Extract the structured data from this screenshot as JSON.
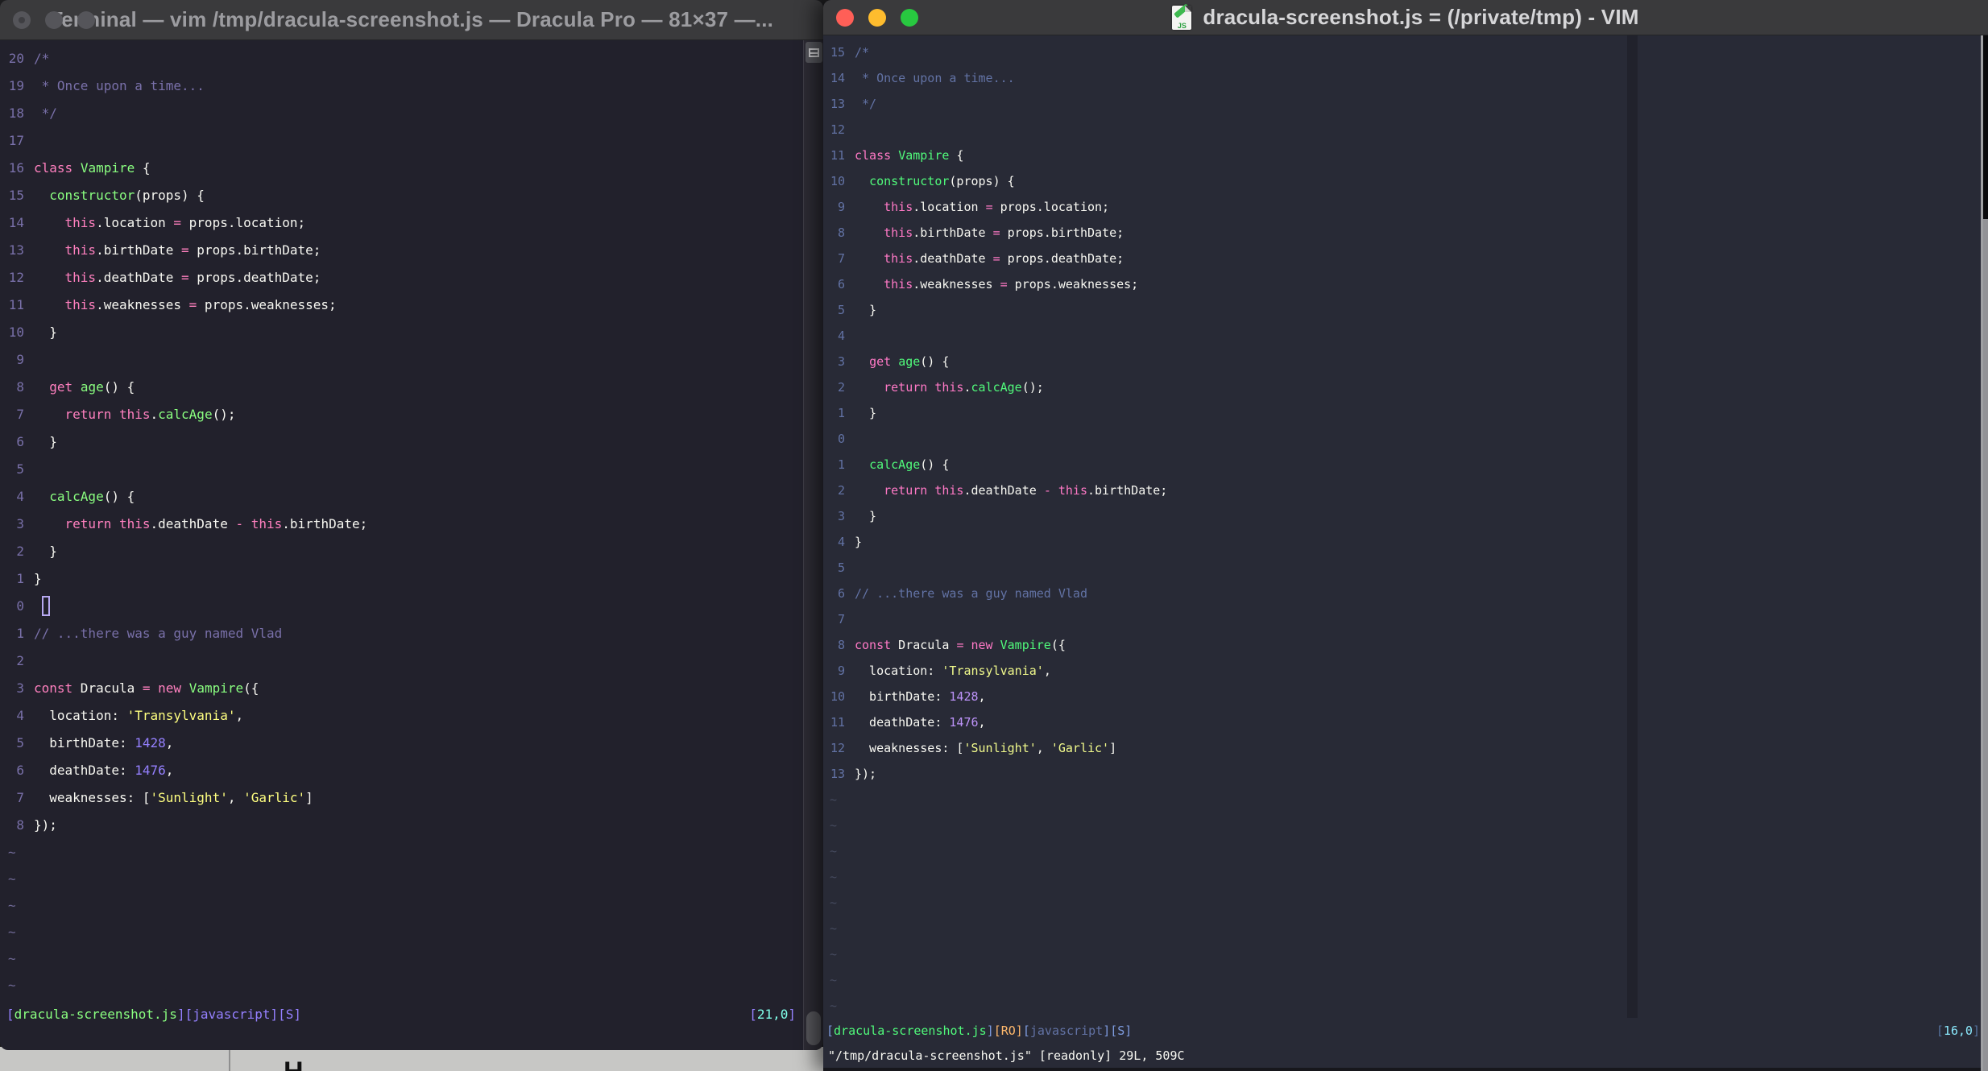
{
  "code_lines": [
    [
      [
        "c",
        "/*"
      ]
    ],
    [
      [
        "c",
        " * Once upon a time..."
      ]
    ],
    [
      [
        "c",
        " */"
      ]
    ],
    [],
    [
      [
        "p",
        "class"
      ],
      [
        "n",
        " "
      ],
      [
        "g",
        "Vampire"
      ],
      [
        "n",
        " {"
      ]
    ],
    [
      [
        "n",
        "  "
      ],
      [
        "g",
        "constructor"
      ],
      [
        "n",
        "(props) {"
      ]
    ],
    [
      [
        "n",
        "    "
      ],
      [
        "p",
        "this"
      ],
      [
        "n",
        ".location "
      ],
      [
        "p",
        "="
      ],
      [
        "n",
        " props.location;"
      ]
    ],
    [
      [
        "n",
        "    "
      ],
      [
        "p",
        "this"
      ],
      [
        "n",
        ".birthDate "
      ],
      [
        "p",
        "="
      ],
      [
        "n",
        " props.birthDate;"
      ]
    ],
    [
      [
        "n",
        "    "
      ],
      [
        "p",
        "this"
      ],
      [
        "n",
        ".deathDate "
      ],
      [
        "p",
        "="
      ],
      [
        "n",
        " props.deathDate;"
      ]
    ],
    [
      [
        "n",
        "    "
      ],
      [
        "p",
        "this"
      ],
      [
        "n",
        ".weaknesses "
      ],
      [
        "p",
        "="
      ],
      [
        "n",
        " props.weaknesses;"
      ]
    ],
    [
      [
        "n",
        "  }"
      ]
    ],
    [],
    [
      [
        "n",
        "  "
      ],
      [
        "p",
        "get"
      ],
      [
        "n",
        " "
      ],
      [
        "g",
        "age"
      ],
      [
        "n",
        "() {"
      ]
    ],
    [
      [
        "n",
        "    "
      ],
      [
        "p",
        "return"
      ],
      [
        "n",
        " "
      ],
      [
        "p",
        "this"
      ],
      [
        "n",
        "."
      ],
      [
        "g",
        "calcAge"
      ],
      [
        "n",
        "();"
      ]
    ],
    [
      [
        "n",
        "  }"
      ]
    ],
    [],
    [
      [
        "n",
        "  "
      ],
      [
        "g",
        "calcAge"
      ],
      [
        "n",
        "() {"
      ]
    ],
    [
      [
        "n",
        "    "
      ],
      [
        "p",
        "return"
      ],
      [
        "n",
        " "
      ],
      [
        "p",
        "this"
      ],
      [
        "n",
        ".deathDate "
      ],
      [
        "p",
        "-"
      ],
      [
        "n",
        " "
      ],
      [
        "p",
        "this"
      ],
      [
        "n",
        ".birthDate;"
      ]
    ],
    [
      [
        "n",
        "  }"
      ]
    ],
    [
      [
        "n",
        "}"
      ]
    ],
    [],
    [
      [
        "c",
        "// ...there was a guy named Vlad"
      ]
    ],
    [],
    [
      [
        "p",
        "const"
      ],
      [
        "n",
        " Dracula "
      ],
      [
        "p",
        "="
      ],
      [
        "n",
        " "
      ],
      [
        "p",
        "new"
      ],
      [
        "n",
        " "
      ],
      [
        "g",
        "Vampire"
      ],
      [
        "n",
        "({"
      ]
    ],
    [
      [
        "n",
        "  location: "
      ],
      [
        "y",
        "'Transylvania'"
      ],
      [
        "n",
        ","
      ]
    ],
    [
      [
        "n",
        "  birthDate: "
      ],
      [
        "u",
        "1428"
      ],
      [
        "n",
        ","
      ]
    ],
    [
      [
        "n",
        "  deathDate: "
      ],
      [
        "u",
        "1476"
      ],
      [
        "n",
        ","
      ]
    ],
    [
      [
        "n",
        "  weaknesses: ["
      ],
      [
        "y",
        "'Sunlight'"
      ],
      [
        "n",
        ", "
      ],
      [
        "y",
        "'Garlic'"
      ],
      [
        "n",
        "]"
      ]
    ],
    [
      [
        "n",
        "});"
      ]
    ]
  ],
  "left_window": {
    "titlebar": {
      "title": "Terminal — vim /tmp/dracula-screenshot.js — Dracula Pro — 81×37 —...",
      "traffic_lights": {
        "close": "#55555a",
        "minimize": "#55555a",
        "zoom": "#55555a"
      }
    },
    "theme_name": "Dracula Pro",
    "palette": {
      "bg": "#22212c",
      "fg": "#f8f8f2",
      "comment": "#7970a9",
      "linenr": "#7970a9",
      "pink": "#ff80bf",
      "green": "#8aff80",
      "yellow": "#ffff80",
      "purple": "#9580ff",
      "cyan": "#80ffea",
      "orange": "#ffca80",
      "blue": "#9580ff",
      "bracketdim": "#9580ff",
      "tilde": "#6e6894"
    },
    "line_numbers": [
      "20",
      "19",
      "18",
      "17",
      "16",
      "15",
      "14",
      "13",
      "12",
      "11",
      "10",
      " 9",
      " 8",
      " 7",
      " 6",
      " 5",
      " 4",
      " 3",
      " 2",
      " 1",
      " 0",
      " 1",
      " 2",
      " 3",
      " 4",
      " 5",
      " 6",
      " 7",
      " 8"
    ],
    "cursor_line_index": 20,
    "tilde": "~",
    "tilde_count": 6,
    "statusline": {
      "left_segments": [
        [
          "u",
          "["
        ],
        [
          "g",
          "dracula-screenshot.js"
        ],
        [
          "u",
          "][javascript][S]"
        ]
      ],
      "right_segments": [
        [
          "u",
          "["
        ],
        [
          "cy",
          "21,0"
        ],
        [
          "u",
          "]"
        ]
      ]
    },
    "cmdline": ""
  },
  "right_window": {
    "titlebar": {
      "title": "dracula-screenshot.js = (/private/tmp) - VIM",
      "icon_label": "JS",
      "traffic_lights": {
        "close": "#ff5f57",
        "minimize": "#febc2e",
        "zoom": "#28c840"
      }
    },
    "theme_name": "Dracula",
    "palette": {
      "bg": "#282a36",
      "fg": "#f8f8f2",
      "comment": "#6272a4",
      "linenr": "#6272a4",
      "pink": "#ff79c6",
      "green": "#50fa7b",
      "yellow": "#f1fa8c",
      "purple": "#bd93f9",
      "cyan": "#8be9fd",
      "orange": "#ffb86c",
      "blue": "#7e9ce0",
      "bracketdim": "#55729e",
      "tilde": "#454a5e"
    },
    "line_numbers": [
      "15",
      "14",
      "13",
      "12",
      "11",
      "10",
      " 9",
      " 8",
      " 7",
      " 6",
      " 5",
      " 4",
      " 3",
      " 2",
      " 1",
      " 0",
      " 1",
      " 2",
      " 3",
      " 4",
      " 5",
      " 6",
      " 7",
      " 8",
      " 9",
      "10",
      "11",
      "12",
      "13"
    ],
    "cursor_line_index": -1,
    "tilde": "~",
    "tilde_count": 9,
    "statusline": {
      "left_segments": [
        [
          "b",
          "["
        ],
        [
          "g",
          "dracula-screenshot.js"
        ],
        [
          "b",
          "]"
        ],
        [
          "o",
          "[RO]"
        ],
        [
          "b",
          "["
        ],
        [
          "c",
          "javascript"
        ],
        [
          "b",
          "][S]"
        ]
      ],
      "right_segments": [
        [
          "bd",
          "["
        ],
        [
          "cy",
          "16,0"
        ],
        [
          "bd",
          "]"
        ]
      ]
    },
    "cmdline": "\"/tmp/dracula-screenshot.js\" [readonly] 29L, 509C"
  }
}
